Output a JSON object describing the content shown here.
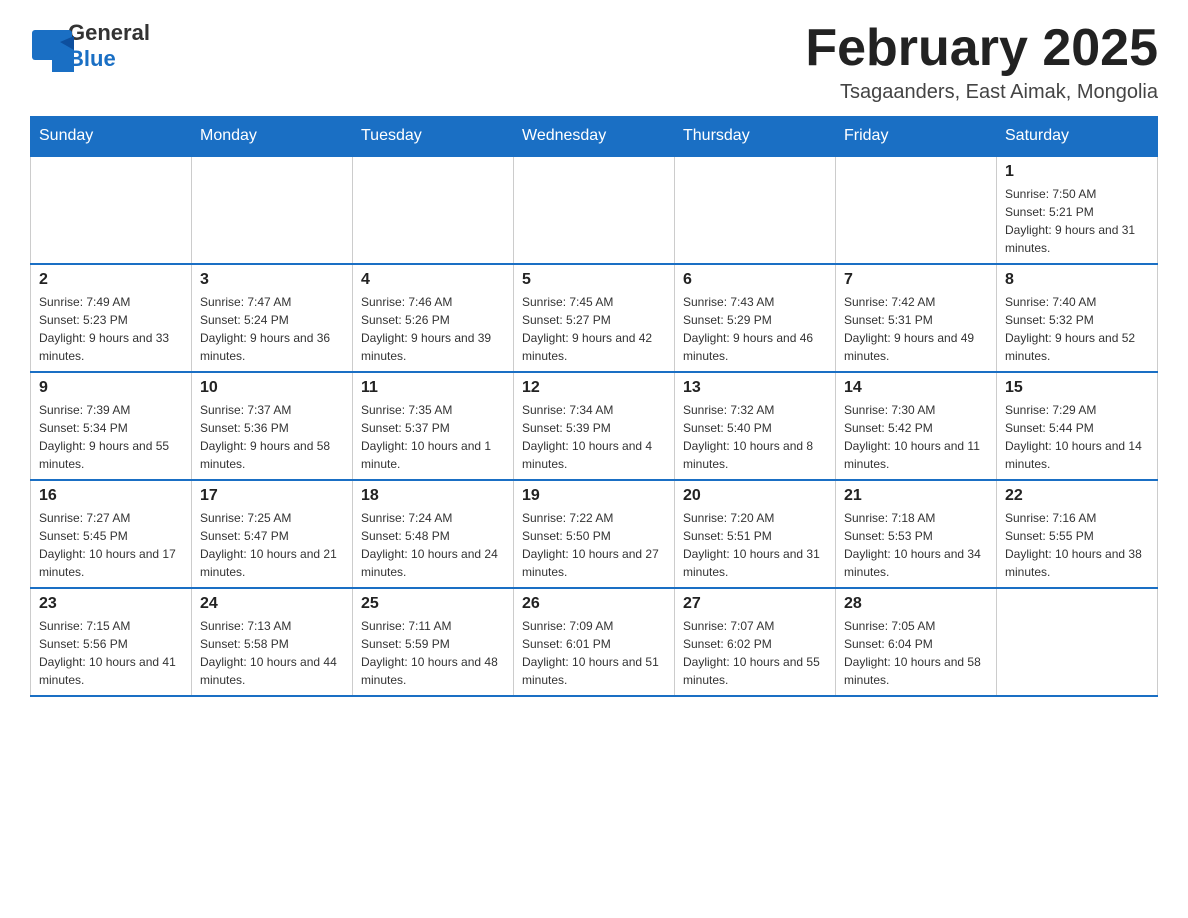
{
  "header": {
    "logo_general": "General",
    "logo_blue": "Blue",
    "month_title": "February 2025",
    "location": "Tsagaanders, East Aimak, Mongolia"
  },
  "days_of_week": [
    "Sunday",
    "Monday",
    "Tuesday",
    "Wednesday",
    "Thursday",
    "Friday",
    "Saturday"
  ],
  "weeks": [
    [
      {
        "day": "",
        "info": ""
      },
      {
        "day": "",
        "info": ""
      },
      {
        "day": "",
        "info": ""
      },
      {
        "day": "",
        "info": ""
      },
      {
        "day": "",
        "info": ""
      },
      {
        "day": "",
        "info": ""
      },
      {
        "day": "1",
        "info": "Sunrise: 7:50 AM\nSunset: 5:21 PM\nDaylight: 9 hours and 31 minutes."
      }
    ],
    [
      {
        "day": "2",
        "info": "Sunrise: 7:49 AM\nSunset: 5:23 PM\nDaylight: 9 hours and 33 minutes."
      },
      {
        "day": "3",
        "info": "Sunrise: 7:47 AM\nSunset: 5:24 PM\nDaylight: 9 hours and 36 minutes."
      },
      {
        "day": "4",
        "info": "Sunrise: 7:46 AM\nSunset: 5:26 PM\nDaylight: 9 hours and 39 minutes."
      },
      {
        "day": "5",
        "info": "Sunrise: 7:45 AM\nSunset: 5:27 PM\nDaylight: 9 hours and 42 minutes."
      },
      {
        "day": "6",
        "info": "Sunrise: 7:43 AM\nSunset: 5:29 PM\nDaylight: 9 hours and 46 minutes."
      },
      {
        "day": "7",
        "info": "Sunrise: 7:42 AM\nSunset: 5:31 PM\nDaylight: 9 hours and 49 minutes."
      },
      {
        "day": "8",
        "info": "Sunrise: 7:40 AM\nSunset: 5:32 PM\nDaylight: 9 hours and 52 minutes."
      }
    ],
    [
      {
        "day": "9",
        "info": "Sunrise: 7:39 AM\nSunset: 5:34 PM\nDaylight: 9 hours and 55 minutes."
      },
      {
        "day": "10",
        "info": "Sunrise: 7:37 AM\nSunset: 5:36 PM\nDaylight: 9 hours and 58 minutes."
      },
      {
        "day": "11",
        "info": "Sunrise: 7:35 AM\nSunset: 5:37 PM\nDaylight: 10 hours and 1 minute."
      },
      {
        "day": "12",
        "info": "Sunrise: 7:34 AM\nSunset: 5:39 PM\nDaylight: 10 hours and 4 minutes."
      },
      {
        "day": "13",
        "info": "Sunrise: 7:32 AM\nSunset: 5:40 PM\nDaylight: 10 hours and 8 minutes."
      },
      {
        "day": "14",
        "info": "Sunrise: 7:30 AM\nSunset: 5:42 PM\nDaylight: 10 hours and 11 minutes."
      },
      {
        "day": "15",
        "info": "Sunrise: 7:29 AM\nSunset: 5:44 PM\nDaylight: 10 hours and 14 minutes."
      }
    ],
    [
      {
        "day": "16",
        "info": "Sunrise: 7:27 AM\nSunset: 5:45 PM\nDaylight: 10 hours and 17 minutes."
      },
      {
        "day": "17",
        "info": "Sunrise: 7:25 AM\nSunset: 5:47 PM\nDaylight: 10 hours and 21 minutes."
      },
      {
        "day": "18",
        "info": "Sunrise: 7:24 AM\nSunset: 5:48 PM\nDaylight: 10 hours and 24 minutes."
      },
      {
        "day": "19",
        "info": "Sunrise: 7:22 AM\nSunset: 5:50 PM\nDaylight: 10 hours and 27 minutes."
      },
      {
        "day": "20",
        "info": "Sunrise: 7:20 AM\nSunset: 5:51 PM\nDaylight: 10 hours and 31 minutes."
      },
      {
        "day": "21",
        "info": "Sunrise: 7:18 AM\nSunset: 5:53 PM\nDaylight: 10 hours and 34 minutes."
      },
      {
        "day": "22",
        "info": "Sunrise: 7:16 AM\nSunset: 5:55 PM\nDaylight: 10 hours and 38 minutes."
      }
    ],
    [
      {
        "day": "23",
        "info": "Sunrise: 7:15 AM\nSunset: 5:56 PM\nDaylight: 10 hours and 41 minutes."
      },
      {
        "day": "24",
        "info": "Sunrise: 7:13 AM\nSunset: 5:58 PM\nDaylight: 10 hours and 44 minutes."
      },
      {
        "day": "25",
        "info": "Sunrise: 7:11 AM\nSunset: 5:59 PM\nDaylight: 10 hours and 48 minutes."
      },
      {
        "day": "26",
        "info": "Sunrise: 7:09 AM\nSunset: 6:01 PM\nDaylight: 10 hours and 51 minutes."
      },
      {
        "day": "27",
        "info": "Sunrise: 7:07 AM\nSunset: 6:02 PM\nDaylight: 10 hours and 55 minutes."
      },
      {
        "day": "28",
        "info": "Sunrise: 7:05 AM\nSunset: 6:04 PM\nDaylight: 10 hours and 58 minutes."
      },
      {
        "day": "",
        "info": ""
      }
    ]
  ]
}
